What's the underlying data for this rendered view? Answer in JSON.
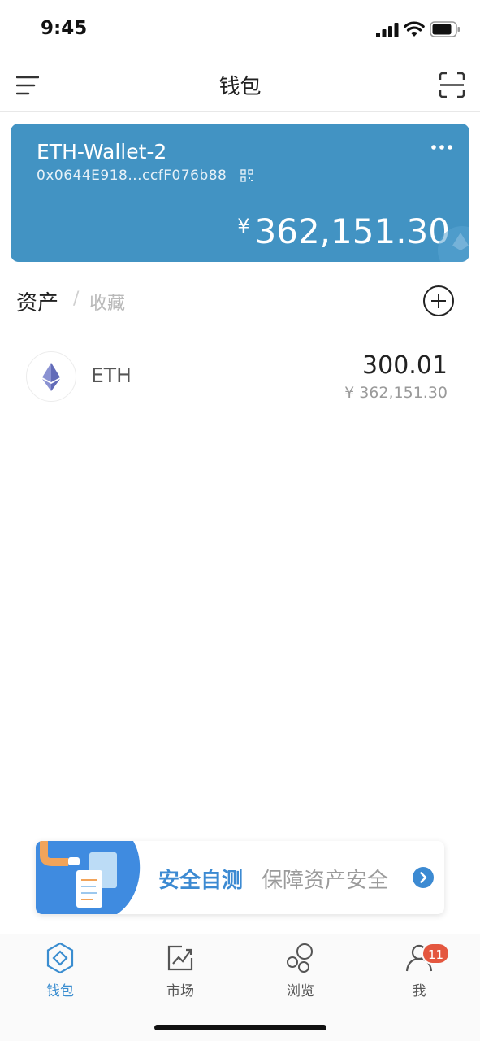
{
  "status_bar": {
    "time": "9:45"
  },
  "header": {
    "title": "钱包"
  },
  "wallet_card": {
    "name": "ETH-Wallet-2",
    "address": "0x0644E918...ccfF076b88",
    "currency_symbol": "¥",
    "balance": "362,151.30",
    "background_color": "#4293c3"
  },
  "assets_section": {
    "tabs": [
      "资产",
      "收藏"
    ],
    "separator": "/"
  },
  "assets": [
    {
      "symbol": "ETH",
      "amount": "300.01",
      "value": "¥ 362,151.30",
      "icon": "ethereum-icon"
    }
  ],
  "banner": {
    "title": "安全自测",
    "subtitle": "保障资产安全",
    "accent_color": "#3c8ad2"
  },
  "tabbar": {
    "items": [
      {
        "label": "钱包",
        "icon": "wallet-icon",
        "active": true
      },
      {
        "label": "市场",
        "icon": "market-chart-icon",
        "active": false
      },
      {
        "label": "浏览",
        "icon": "browse-bubbles-icon",
        "active": false
      },
      {
        "label": "我",
        "icon": "profile-icon",
        "active": false
      }
    ],
    "active_color": "#3a8dd0",
    "inactive_color": "#555555",
    "me_badge": "11"
  }
}
